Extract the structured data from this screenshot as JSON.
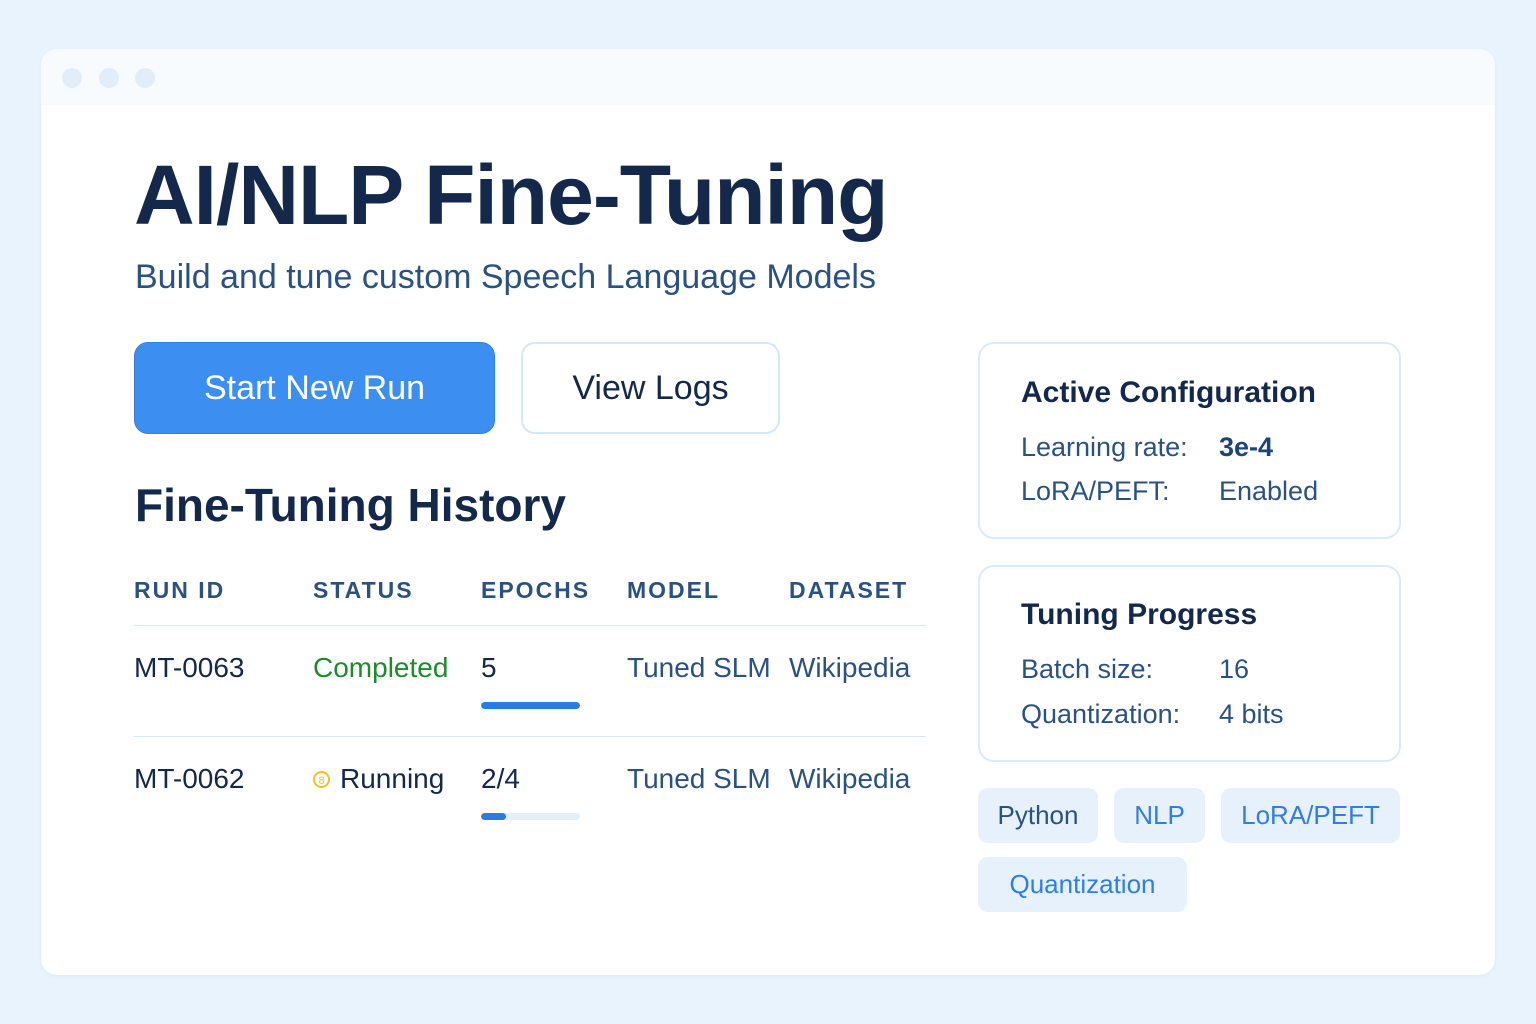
{
  "header": {
    "title": "AI/NLP Fine-Tuning",
    "subtitle": "Build and tune custom Speech Language Models"
  },
  "actions": {
    "start_label": "Start New Run",
    "logs_label": "View Logs"
  },
  "history": {
    "title": "Fine-Tuning History",
    "columns": [
      "RUN ID",
      "STATUS",
      "EPOCHS",
      "MODEL",
      "DATASET"
    ],
    "rows": [
      {
        "run_id": "MT-0063",
        "status": "Completed",
        "status_icon": "",
        "epochs": "5",
        "progress": 1.0,
        "model": "Tuned SLM",
        "dataset": "Wikipedia"
      },
      {
        "run_id": "MT-0062",
        "status": "Running",
        "status_icon": "spinner-icon",
        "epochs": "2/4",
        "progress": 0.25,
        "model": "Tuned SLM",
        "dataset": "Wikipedia"
      }
    ]
  },
  "active_config": {
    "title": "Active Configuration",
    "items": [
      {
        "label": "Learning rate:",
        "value": "3e-4"
      },
      {
        "label": "LoRA/PEFT:",
        "value": "Enabled"
      }
    ]
  },
  "tuning_progress": {
    "title": "Tuning Progress",
    "items": [
      {
        "label": "Batch size:",
        "value": "16"
      },
      {
        "label": "Quantization:",
        "value": "4 bits"
      }
    ]
  },
  "tags": [
    "Python",
    "NLP",
    "LoRA/PEFT",
    "Quantization"
  ],
  "colors": {
    "background": "#e8f3fd",
    "primary": "#3c8ff0",
    "text_dark": "#13284a",
    "text_muted": "#2b5180",
    "success": "#1f8a2e",
    "warning": "#f3c02c",
    "progress": "#2d7be0",
    "tag_bg": "#e6f1fc"
  }
}
